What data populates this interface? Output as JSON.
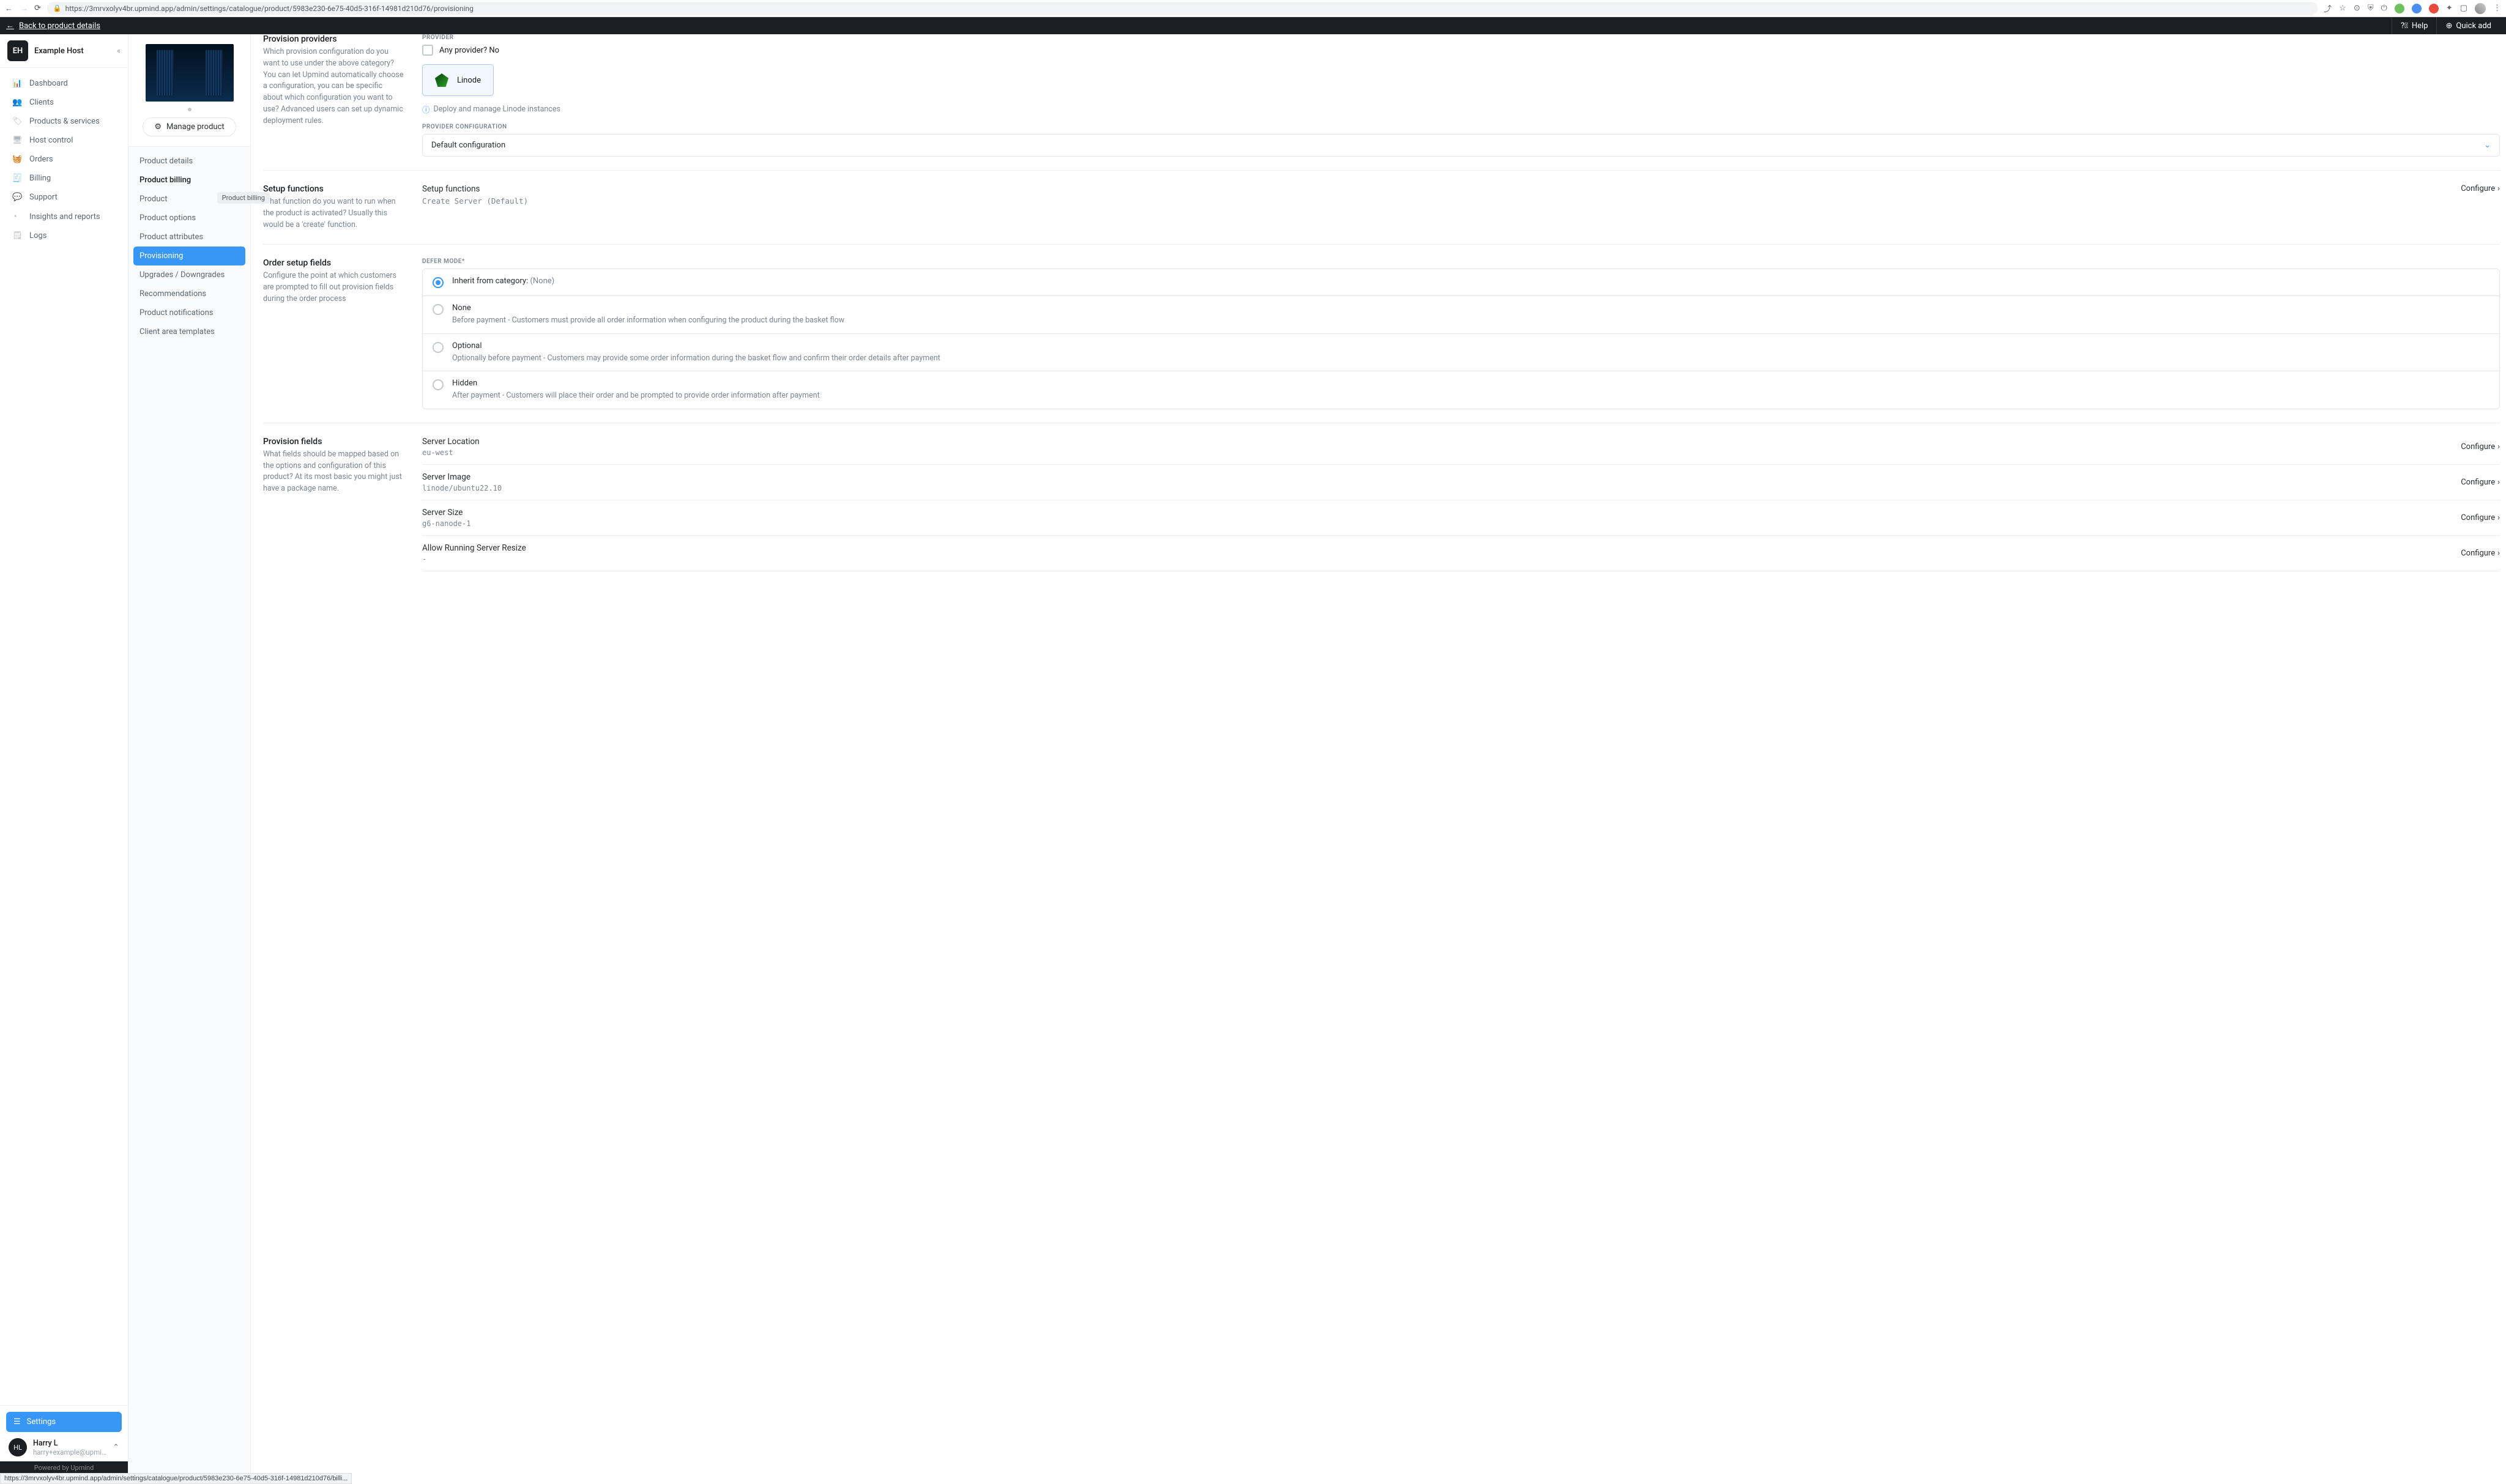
{
  "browser": {
    "url": "https://3mrvxolyv4br.upmind.app/admin/settings/catalogue/product/5983e230-6e75-40d5-316f-14981d210d76/provisioning",
    "status_url": "https://3mrvxolyv4br.upmind.app/admin/settings/catalogue/product/5983e230-6e75-40d5-316f-14981d210d76/billi..."
  },
  "topbar": {
    "back": "Back to product details",
    "help": "Help",
    "quick_add": "Quick add"
  },
  "brand": {
    "initials": "EH",
    "name": "Example Host"
  },
  "left_nav": [
    {
      "id": "dashboard",
      "label": "Dashboard",
      "icon": "📊"
    },
    {
      "id": "clients",
      "label": "Clients",
      "icon": "👥"
    },
    {
      "id": "products",
      "label": "Products & services",
      "icon": "🏷"
    },
    {
      "id": "host-control",
      "label": "Host control",
      "icon": "🖥"
    },
    {
      "id": "orders",
      "label": "Orders",
      "icon": "🧺"
    },
    {
      "id": "billing",
      "label": "Billing",
      "icon": "🧾"
    },
    {
      "id": "support",
      "label": "Support",
      "icon": "💬"
    },
    {
      "id": "insights",
      "label": "Insights and reports",
      "icon": "◔"
    },
    {
      "id": "logs",
      "label": "Logs",
      "icon": "🗒"
    }
  ],
  "settings_label": "Settings",
  "user": {
    "initials": "HL",
    "name": "Harry L",
    "email": "harry+example@upmind...."
  },
  "powered": "Powered by Upmind",
  "manage_product": "Manage product",
  "product_nav": [
    {
      "id": "details",
      "label": "Product details"
    },
    {
      "id": "billing",
      "label": "Product billing",
      "current": true
    },
    {
      "id": "product",
      "label": "Product",
      "tooltip": "Product billing"
    },
    {
      "id": "options",
      "label": "Product options"
    },
    {
      "id": "attributes",
      "label": "Product attributes"
    },
    {
      "id": "provisioning",
      "label": "Provisioning",
      "active": true
    },
    {
      "id": "upgrades",
      "label": "Upgrades / Downgrades"
    },
    {
      "id": "recommendations",
      "label": "Recommendations"
    },
    {
      "id": "notifications",
      "label": "Product notifications"
    },
    {
      "id": "templates",
      "label": "Client area templates"
    }
  ],
  "sections": {
    "providers": {
      "title": "Provision providers",
      "desc": "Which provision configuration do you want to use under the above category? You can let Upmind automatically choose a configuration, you can be specific about which configuration you want to use? Advanced users can set up dynamic deployment rules.",
      "provider_label": "PROVIDER",
      "any_provider": "Any provider? No",
      "provider_name": "Linode",
      "info": "Deploy and manage Linode instances",
      "config_label": "PROVIDER CONFIGURATION",
      "config_value": "Default configuration"
    },
    "functions": {
      "title": "Setup functions",
      "desc": "What function do you want to run when the product is activated? Usually this would be a 'create' function.",
      "row_label": "Setup functions",
      "row_value": "Create Server (Default)",
      "configure": "Configure"
    },
    "order_setup": {
      "title": "Order setup fields",
      "desc": "Configure the point at which customers are prompted to fill out provision fields during the order process",
      "defer_label": "DEFER MODE*",
      "options": [
        {
          "id": "inherit",
          "label": "Inherit from category:",
          "extra": "(None)",
          "selected": true
        },
        {
          "id": "none",
          "label": "None",
          "sub": "Before payment - Customers must provide all order information when configuring the product during the basket flow"
        },
        {
          "id": "optional",
          "label": "Optional",
          "sub": "Optionally before payment - Customers may provide some order information during the basket flow and confirm their order details after payment"
        },
        {
          "id": "hidden",
          "label": "Hidden",
          "sub": "After payment - Customers will place their order and be prompted to provide order information after payment"
        }
      ]
    },
    "provision_fields": {
      "title": "Provision fields",
      "desc": "What fields should be mapped based on the options and configuration of this product? At its most basic you might just have a package name.",
      "configure": "Configure",
      "rows": [
        {
          "label": "Server Location",
          "value": "eu-west"
        },
        {
          "label": "Server Image",
          "value": "linode/ubuntu22.10"
        },
        {
          "label": "Server Size",
          "value": "g6-nanode-1"
        },
        {
          "label": "Allow Running Server Resize",
          "value": "-"
        }
      ]
    }
  }
}
